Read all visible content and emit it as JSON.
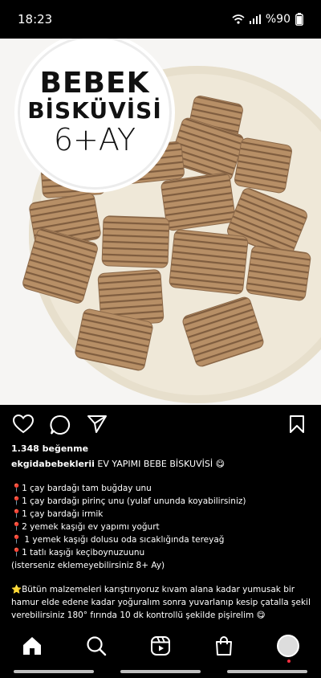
{
  "status_bar": {
    "time": "18:23",
    "battery": "%90"
  },
  "post_image": {
    "overlay_title_line1": "BEBEK",
    "overlay_title_line2": "BİSKÜVİSİ",
    "overlay_title_line3": "6+AY"
  },
  "post": {
    "likes": "1.348 beğenme",
    "username": "ekgidabebeklerii",
    "title": "EV YAPIMI BEBE BİSKUVİSİ 😋",
    "ingredients": [
      "📍1 çay bardağı tam buğday unu",
      "📍1 çay bardağı pirinç unu (yulaf ununda koyabilirsiniz)",
      "📍1 çay bardağı irmik",
      "📍2 yemek kaşığı ev yapımı yoğurt",
      "📍 1 yemek kaşığı  dolusu oda sıcaklığında tereyağ",
      "📍1 tatlı kaşığı keçiboynuzuunu",
      "(isterseniz eklemeyebilirsiniz  8+ Ay)"
    ],
    "instructions": "⭐Bütün malzemeleri karıştırıyoruz kıvam alana kadar yumusak bir hamur elde edene kadar yoğuralım sonra yuvarlanıp kesip çatalla şekil verebilirsiniz 180° fırında  10 dk kontrollü  şekilde  pişirelim 😋"
  },
  "icons": {
    "like": "heart-icon",
    "comment": "comment-icon",
    "share": "send-icon",
    "save": "bookmark-icon",
    "nav": [
      "home-icon",
      "search-icon",
      "reels-icon",
      "shop-icon",
      "profile-avatar"
    ]
  },
  "colors": {
    "background": "#000000",
    "text": "#ffffff",
    "plate": "#efe8d8",
    "cookie": "#b78f66",
    "notification_dot": "#ff3040"
  }
}
